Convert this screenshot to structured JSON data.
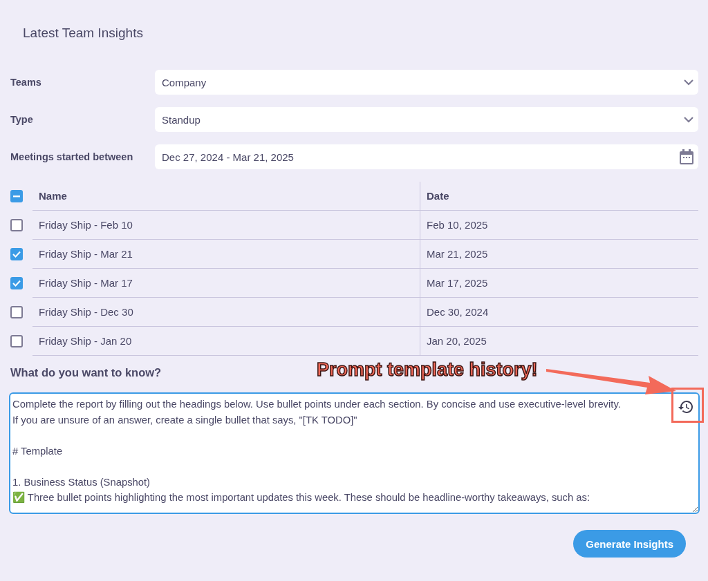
{
  "title": "Latest Team Insights",
  "fields": [
    {
      "label": "Teams",
      "kind": "select",
      "value": "Company"
    },
    {
      "label": "Type",
      "kind": "select",
      "value": "Standup"
    },
    {
      "label": "Meetings started between",
      "kind": "date",
      "value": "Dec 27, 2024 - Mar 21, 2025"
    }
  ],
  "table": {
    "select_all": {
      "indeterminate": true
    },
    "columns": [
      "Name",
      "Date"
    ],
    "rows": [
      {
        "checked": false,
        "name": "Friday Ship - Feb 10",
        "date": "Feb 10, 2025"
      },
      {
        "checked": true,
        "name": "Friday Ship - Mar 21",
        "date": "Mar 21, 2025"
      },
      {
        "checked": true,
        "name": "Friday Ship - Mar 17",
        "date": "Mar 17, 2025"
      },
      {
        "checked": false,
        "name": "Friday Ship - Dec 30",
        "date": "Dec 30, 2024"
      },
      {
        "checked": false,
        "name": "Friday Ship - Jan 20",
        "date": "Jan 20, 2025"
      }
    ]
  },
  "question": {
    "label": "What do you want to know?",
    "value": "Complete the report by filling out the headings below. Use bullet points under each section. By concise and use executive-level brevity.\nIf you are unsure of an answer, create a single bullet that says, \"[TK TODO]\"\n\n# Template\n\n1. Business Status (Snapshot)\n✅ Three bullet points highlighting the most important updates this week. These should be headline-worthy takeaways, such as:"
  },
  "annotation": {
    "text": "Prompt template history!"
  },
  "button": "Generate Insights"
}
